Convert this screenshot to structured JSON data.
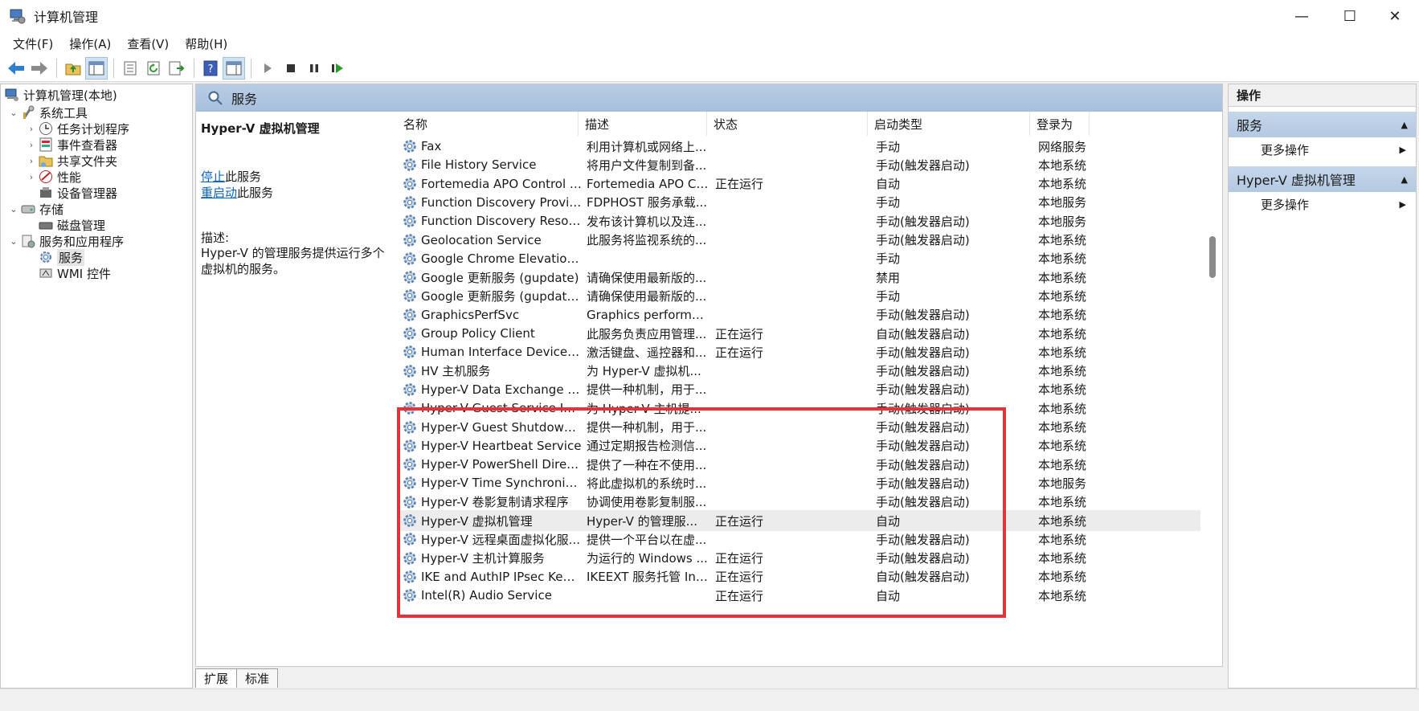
{
  "window": {
    "title": "计算机管理",
    "minimize": "—",
    "maximize": "☐",
    "close": "✕"
  },
  "menu": [
    "文件(F)",
    "操作(A)",
    "查看(V)",
    "帮助(H)"
  ],
  "tree": {
    "root": "计算机管理(本地)",
    "system_tools": "系统工具",
    "task_scheduler": "任务计划程序",
    "event_viewer": "事件查看器",
    "shared_folders": "共享文件夹",
    "performance": "性能",
    "device_manager": "设备管理器",
    "storage": "存储",
    "disk_management": "磁盘管理",
    "services_apps": "服务和应用程序",
    "services": "服务",
    "wmi": "WMI 控件"
  },
  "center": {
    "header": "服务",
    "detail_title": "Hyper-V 虚拟机管理",
    "stop_link": "停止",
    "stop_suffix": "此服务",
    "restart_link": "重启动",
    "restart_suffix": "此服务",
    "desc_label": "描述:",
    "desc_text": "Hyper-V 的管理服务提供运行多个虚拟机的服务。",
    "columns": [
      "名称",
      "描述",
      "状态",
      "启动类型",
      "登录为"
    ],
    "rows": [
      [
        "Fax",
        "利用计算机或网络上...",
        "",
        "手动",
        "网络服务"
      ],
      [
        "File History Service",
        "将用户文件复制到备...",
        "",
        "手动(触发器启动)",
        "本地系统"
      ],
      [
        "Fortemedia APO Control S...",
        "Fortemedia APO Co...",
        "正在运行",
        "自动",
        "本地系统"
      ],
      [
        "Function Discovery Provide...",
        "FDPHOST 服务承载...",
        "",
        "手动",
        "本地服务"
      ],
      [
        "Function Discovery Resour...",
        "发布该计算机以及连...",
        "",
        "手动(触发器启动)",
        "本地服务"
      ],
      [
        "Geolocation Service",
        "此服务将监视系统的...",
        "",
        "手动(触发器启动)",
        "本地系统"
      ],
      [
        "Google Chrome Elevation ...",
        "",
        "",
        "手动",
        "本地系统"
      ],
      [
        "Google 更新服务 (gupdate)",
        "请确保使用最新版的...",
        "",
        "禁用",
        "本地系统"
      ],
      [
        "Google 更新服务 (gupdate...",
        "请确保使用最新版的...",
        "",
        "手动",
        "本地系统"
      ],
      [
        "GraphicsPerfSvc",
        "Graphics performan...",
        "",
        "手动(触发器启动)",
        "本地系统"
      ],
      [
        "Group Policy Client",
        "此服务负责应用管理...",
        "正在运行",
        "自动(触发器启动)",
        "本地系统"
      ],
      [
        "Human Interface Device S...",
        "激活键盘、遥控器和...",
        "正在运行",
        "手动(触发器启动)",
        "本地系统"
      ],
      [
        "HV 主机服务",
        "为 Hyper-V 虚拟机...",
        "",
        "手动(触发器启动)",
        "本地系统"
      ],
      [
        "Hyper-V Data Exchange Se...",
        "提供一种机制，用于...",
        "",
        "手动(触发器启动)",
        "本地系统"
      ],
      [
        "Hyper-V Guest Service Int...",
        "为 Hyper-V 主机提...",
        "",
        "手动(触发器启动)",
        "本地系统"
      ],
      [
        "Hyper-V Guest Shutdown ...",
        "提供一种机制，用于...",
        "",
        "手动(触发器启动)",
        "本地系统"
      ],
      [
        "Hyper-V Heartbeat Service",
        "通过定期报告检测信...",
        "",
        "手动(触发器启动)",
        "本地系统"
      ],
      [
        "Hyper-V PowerShell Direct...",
        "提供了一种在不使用...",
        "",
        "手动(触发器启动)",
        "本地系统"
      ],
      [
        "Hyper-V Time Synchroniza...",
        "将此虚拟机的系统时...",
        "",
        "手动(触发器启动)",
        "本地服务"
      ],
      [
        "Hyper-V 卷影复制请求程序",
        "协调使用卷影复制服...",
        "",
        "手动(触发器启动)",
        "本地系统"
      ],
      [
        "Hyper-V 虚拟机管理",
        "Hyper-V 的管理服...",
        "正在运行",
        "自动",
        "本地系统"
      ],
      [
        "Hyper-V 远程桌面虚拟化服...",
        "提供一个平台以在虚...",
        "",
        "手动(触发器启动)",
        "本地系统"
      ],
      [
        "Hyper-V 主机计算服务",
        "为运行的 Windows ...",
        "正在运行",
        "手动(触发器启动)",
        "本地系统"
      ],
      [
        "IKE and AuthIP IPsec Keyin...",
        "IKEEXT 服务托管 Int...",
        "正在运行",
        "自动(触发器启动)",
        "本地系统"
      ],
      [
        "Intel(R) Audio Service",
        "",
        "正在运行",
        "自动",
        "本地系统"
      ]
    ]
  },
  "tabs": [
    "扩展",
    "标准"
  ],
  "actions": {
    "title": "操作",
    "section1": "服务",
    "more1": "更多操作",
    "section2": "Hyper-V 虚拟机管理",
    "more2": "更多操作"
  },
  "colors": {
    "highlight_box": "#e8323a",
    "link": "#0b63c5",
    "pane_header": "#b9cde5"
  }
}
